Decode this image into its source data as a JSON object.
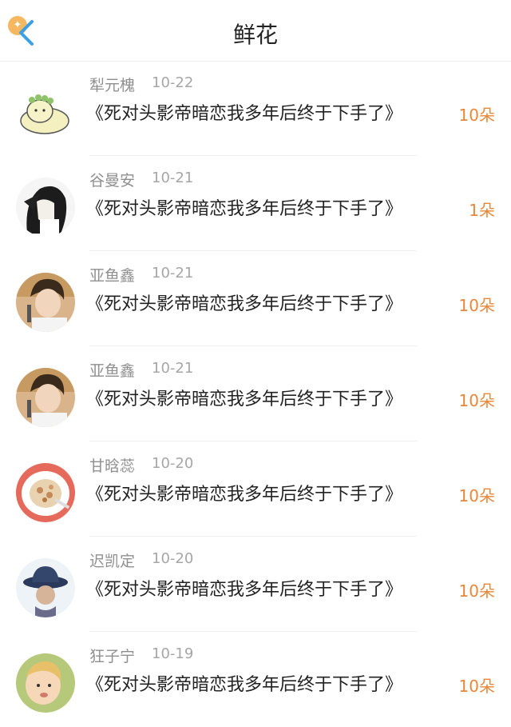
{
  "header": {
    "title": "鲜花",
    "back_icon": "back-chevron-icon"
  },
  "colors": {
    "accent": "#e8873a",
    "name": "#8f8f8f",
    "text": "#222222"
  },
  "items": [
    {
      "name": "犁元槐",
      "date": "10-22",
      "book": "《死对头影帝暗恋我多年后终于下手了》",
      "count": "10朵"
    },
    {
      "name": "谷曼安",
      "date": "10-21",
      "book": "《死对头影帝暗恋我多年后终于下手了》",
      "count": "1朵"
    },
    {
      "name": "亚鱼鑫",
      "date": "10-21",
      "book": "《死对头影帝暗恋我多年后终于下手了》",
      "count": "10朵"
    },
    {
      "name": "亚鱼鑫",
      "date": "10-21",
      "book": "《死对头影帝暗恋我多年后终于下手了》",
      "count": "10朵"
    },
    {
      "name": "甘晗蕊",
      "date": "10-20",
      "book": "《死对头影帝暗恋我多年后终于下手了》",
      "count": "10朵"
    },
    {
      "name": "迟凯定",
      "date": "10-20",
      "book": "《死对头影帝暗恋我多年后终于下手了》",
      "count": "10朵"
    },
    {
      "name": "狂子宁",
      "date": "10-19",
      "book": "《死对头影帝暗恋我多年后终于下手了》",
      "count": "10朵"
    }
  ]
}
